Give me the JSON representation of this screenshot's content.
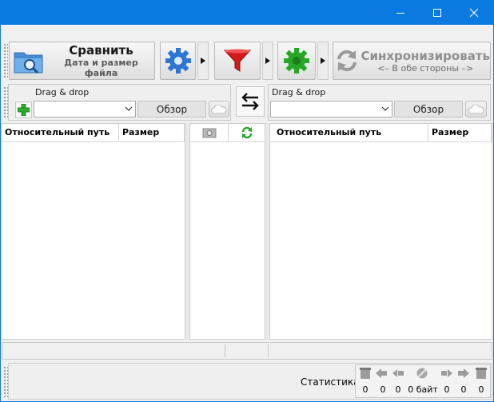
{
  "window": {
    "controls": {
      "minimize": "minimize-icon",
      "maximize": "maximize-icon",
      "close": "close-icon"
    }
  },
  "toolbar": {
    "compare_label": "Сравнить",
    "compare_variant": "Дата и размер файла",
    "sync_label": "Синхронизировать",
    "sync_variant": "<– В обе стороны –>"
  },
  "left": {
    "drag_drop": "Drag & drop",
    "browse": "Обзор",
    "columns": {
      "path": "Относительный путь",
      "size": "Размер"
    }
  },
  "right": {
    "drag_drop": "Drag & drop",
    "browse": "Обзор",
    "columns": {
      "path": "Относительный путь",
      "size": "Размер"
    }
  },
  "statistics": {
    "label": "Статистика:",
    "values": [
      "0",
      "0",
      "0",
      "0 байт",
      "0",
      "0",
      "0"
    ]
  },
  "colors": {
    "titlebar": "#0a7ae0",
    "sync_green": "#26a826",
    "filter_red": "#d41a1a"
  }
}
